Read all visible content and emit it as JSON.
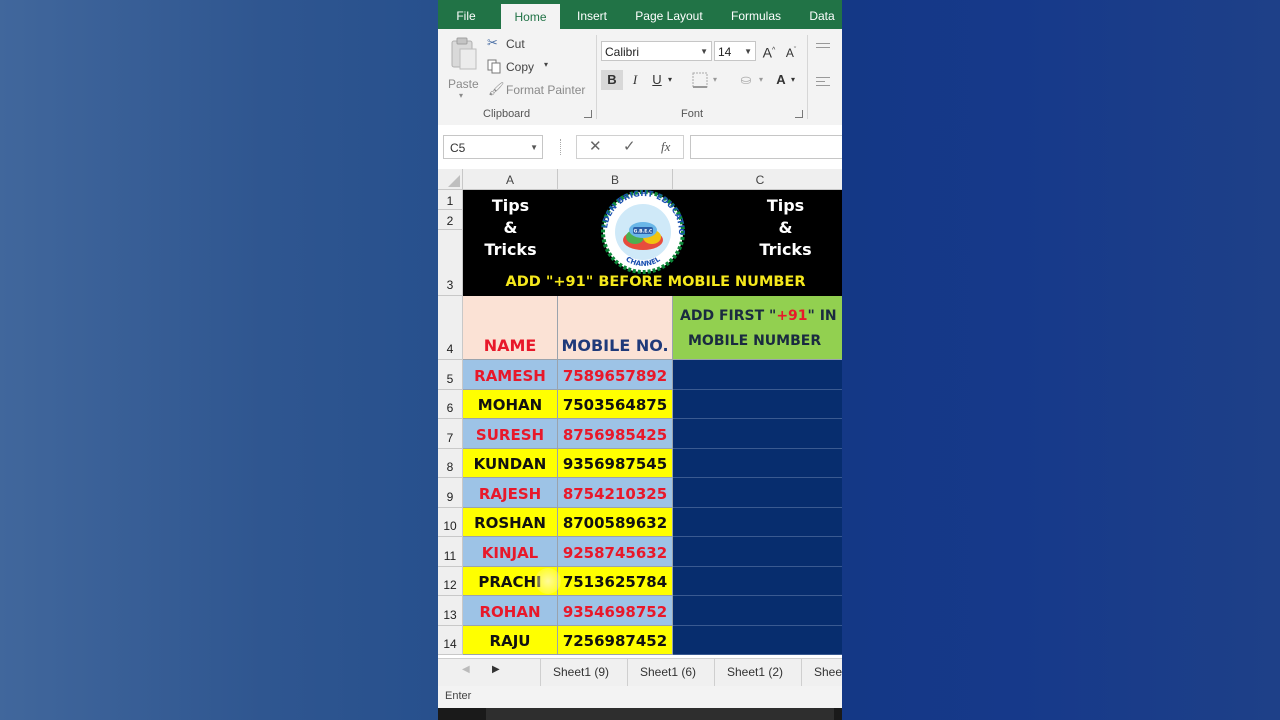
{
  "ribbon": {
    "tabs": [
      "File",
      "Home",
      "Insert",
      "Page Layout",
      "Formulas",
      "Data"
    ],
    "active_tab": "Home",
    "clipboard": {
      "paste": "Paste",
      "cut": "Cut",
      "copy": "Copy",
      "format_painter": "Format Painter",
      "group_label": "Clipboard"
    },
    "font": {
      "font_name": "Calibri",
      "font_size": "14",
      "bold": "B",
      "italic": "I",
      "underline": "U",
      "font_color_glyph": "A",
      "group_label": "Font"
    }
  },
  "formula_bar": {
    "name_box": "C5",
    "fx": "fx",
    "formula": ""
  },
  "grid": {
    "columns": [
      "A",
      "B",
      "C"
    ],
    "row_numbers": [
      "1",
      "2",
      "3",
      "4",
      "5",
      "6",
      "7",
      "8",
      "9",
      "10",
      "11",
      "12",
      "13",
      "14"
    ],
    "banner": {
      "left_text": [
        "Tips",
        "&",
        "Tricks"
      ],
      "right_text": [
        "Tips",
        "&",
        "Tricks"
      ],
      "logo_text_top": "GOLDEN BRIGHT EDUCATION",
      "logo_text_bottom": "CHANNEL",
      "logo_center": "G.B.E.C",
      "title": "ADD \"+91\" BEFORE MOBILE NUMBER"
    },
    "headers": {
      "name": "NAME",
      "mobile": "MOBILE NO.",
      "c_line1_a": "ADD FIRST \"",
      "c_line1_b": "+91",
      "c_line1_c": "\" IN",
      "c_line2": "MOBILE NUMBER"
    },
    "rows": [
      {
        "name": "RAMESH",
        "mobile": "7589657892"
      },
      {
        "name": "MOHAN",
        "mobile": "7503564875"
      },
      {
        "name": "SURESH",
        "mobile": "8756985425"
      },
      {
        "name": "KUNDAN",
        "mobile": "9356987545"
      },
      {
        "name": "RAJESH",
        "mobile": "8754210325"
      },
      {
        "name": "ROSHAN",
        "mobile": "8700589632"
      },
      {
        "name": "KINJAL",
        "mobile": "9258745632"
      },
      {
        "name": "PRACHI",
        "mobile": "7513625784"
      },
      {
        "name": "ROHAN",
        "mobile": "9354698752"
      },
      {
        "name": "RAJU",
        "mobile": "7256987452"
      }
    ]
  },
  "sheet_tabs": [
    "Sheet1 (9)",
    "Sheet1 (6)",
    "Sheet1 (2)",
    "Shee"
  ],
  "status": {
    "mode": "Enter"
  },
  "colors": {
    "excel_green": "#217346",
    "banner_black": "#000000",
    "banner_title_yellow": "#f5e81c",
    "header_peach": "#fbe2d5",
    "header_green": "#92d050",
    "row_blue": "#9dc3e6",
    "row_yellow": "#ffff00",
    "red_text": "#e8182a",
    "navy_text": "#1f3a7a",
    "column_c_navy": "#072d6e"
  }
}
